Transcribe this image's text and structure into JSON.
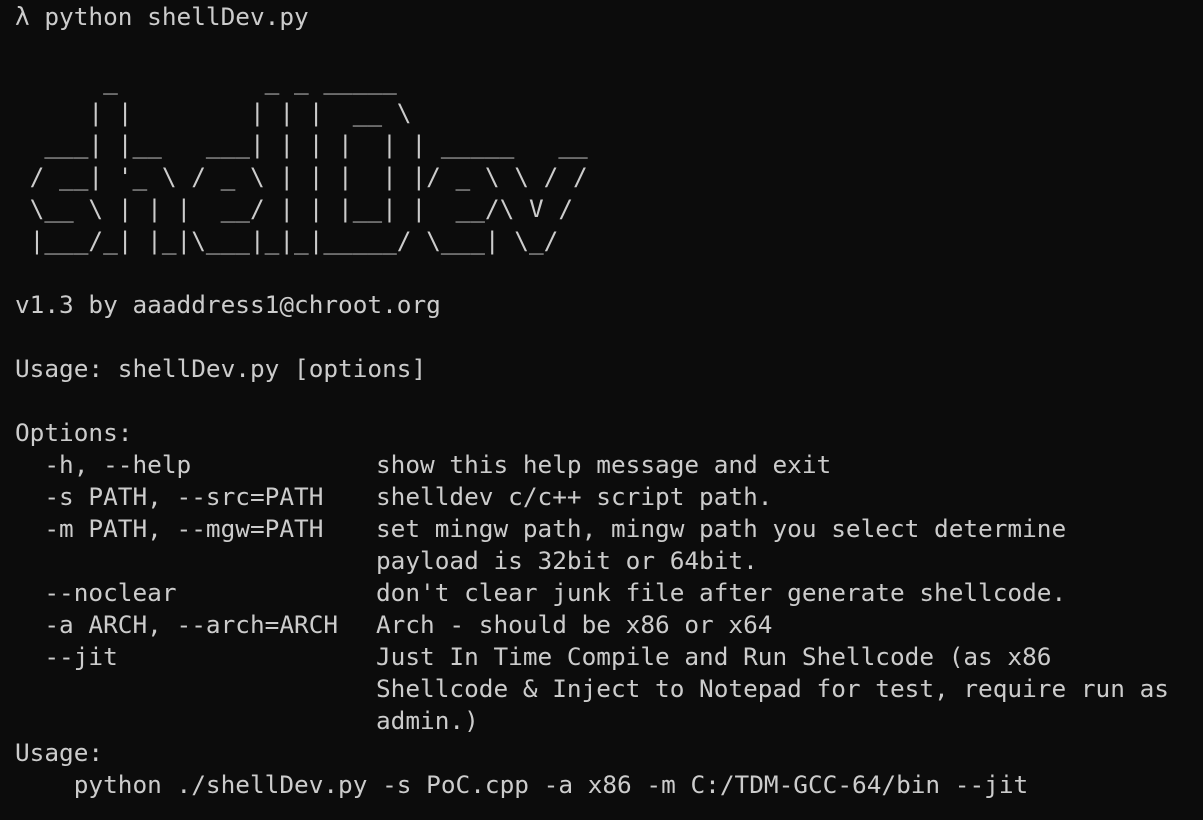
{
  "terminal": {
    "prompt_symbol": "λ",
    "command": "python shellDev.py"
  },
  "banner": [
    "      _          _ _ _____",
    "     | |        | | |  __ \\",
    "  ___| |__   ___| | | |  | | _____   __",
    " / __| '_ \\ / _ \\ | | |  | |/ _ \\ \\ / /",
    " \\__ \\ | | |  __/ | | |__| |  __/\\ V /",
    " |___/_| |_|\\___|_|_|_____/ \\___| \\_/"
  ],
  "version_line": "v1.3 by aaaddress1@chroot.org",
  "usage_line": "Usage: shellDev.py [options]",
  "options_header": "Options:",
  "options": [
    {
      "flag": "  -h, --help",
      "desc": [
        "show this help message and exit"
      ]
    },
    {
      "flag": "  -s PATH, --src=PATH",
      "desc": [
        "shelldev c/c++ script path."
      ]
    },
    {
      "flag": "  -m PATH, --mgw=PATH",
      "desc": [
        "set mingw path, mingw path you select determine",
        "payload is 32bit or 64bit."
      ]
    },
    {
      "flag": "  --noclear",
      "desc": [
        "don't clear junk file after generate shellcode."
      ]
    },
    {
      "flag": "  -a ARCH, --arch=ARCH",
      "desc": [
        "Arch - should be x86 or x64"
      ]
    },
    {
      "flag": "  --jit",
      "desc": [
        "Just In Time Compile and Run Shellcode (as x86",
        "Shellcode & Inject to Notepad for test, require run as",
        "admin.)"
      ]
    }
  ],
  "example_header": "Usage:",
  "example_command": "    python ./shellDev.py -s PoC.cpp -a x86 -m C:/TDM-GCC-64/bin --jit"
}
